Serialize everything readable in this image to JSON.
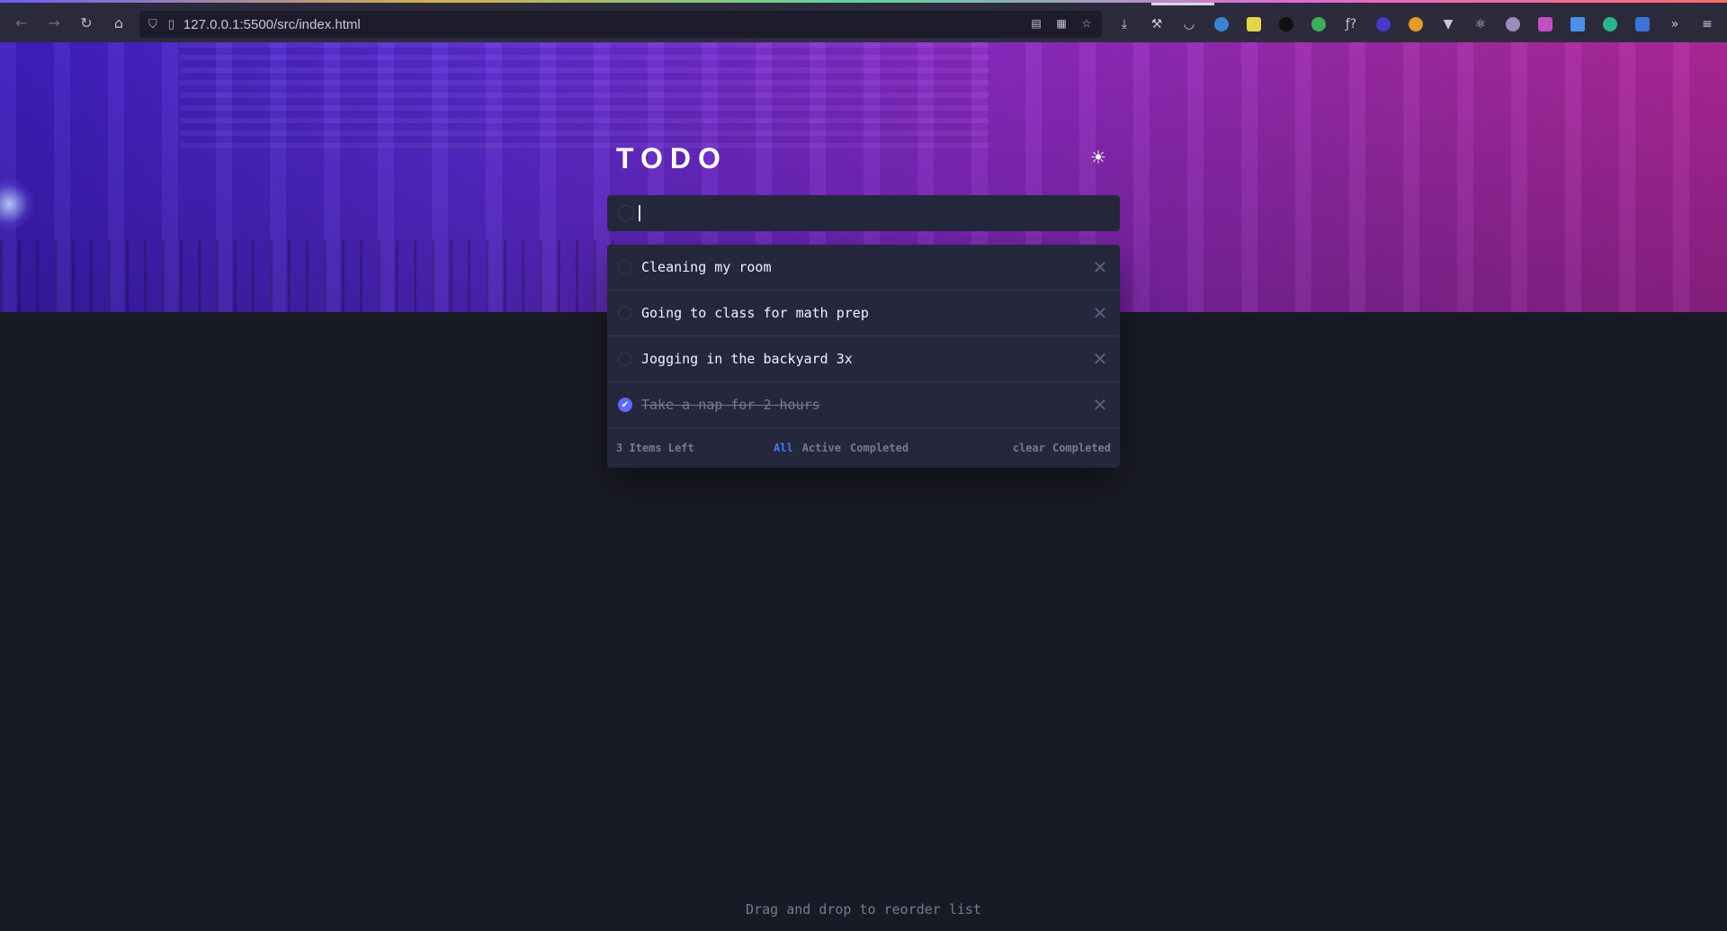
{
  "browser": {
    "url": "127.0.0.1:5500/src/index.html",
    "back_icon": "arrow-left-icon",
    "forward_icon": "arrow-right-icon",
    "reload_icon": "reload-icon",
    "home_icon": "home-icon",
    "accent": "#e26ad5"
  },
  "app": {
    "title": "TODO",
    "theme_icon": "sun-icon",
    "new_todo": {
      "value": "",
      "placeholder": ""
    },
    "items": [
      {
        "text": "Cleaning my room",
        "completed": false
      },
      {
        "text": "Going to class for math prep",
        "completed": false
      },
      {
        "text": "Jogging in the backyard 3x",
        "completed": false
      },
      {
        "text": "Take a nap for 2 hours",
        "completed": true
      }
    ],
    "footer": {
      "items_left": "3 Items Left",
      "filters": [
        "All",
        "Active",
        "Completed"
      ],
      "active_filter": "All",
      "clear_label": "clear",
      "clear_completed_label": "Completed"
    },
    "hint": "Drag and drop to reorder list",
    "colors": {
      "background": "#181a26",
      "card": "#25273c",
      "active_filter": "#3a7bfd",
      "muted": "#777a92"
    }
  }
}
